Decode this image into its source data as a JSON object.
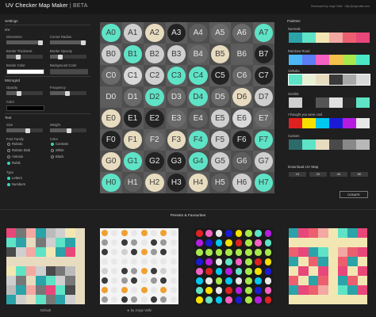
{
  "header": {
    "title": "UV Checker Map Maker",
    "separator": " | ",
    "badge": "BETA",
    "credits": "Developed by Jorge Valle · http://jorgevalle.com"
  },
  "settings": {
    "title": "Settings",
    "uv_section": "UV",
    "dimension_label": "Dimension",
    "corner_radius_label": "Corner Radius",
    "border_thickness_label": "Border Thickness",
    "border_opacity_label": "Border Opacity",
    "border_color_label": "Border Color",
    "background_color_label": "Background Color",
    "microgrid_section": "Microgrid",
    "opacity_label": "Opacity",
    "frequency_label": "Frequency",
    "color_label": "Color",
    "text_section": "Text",
    "size_label": "Size",
    "weight_label": "Weight",
    "font_family_label": "Font Family",
    "fonts": [
      "Roboto",
      "Roboto Slab",
      "Antonio",
      "Rubik"
    ],
    "font_selected": "Rubik",
    "color_section_label": "Color",
    "text_colors": [
      "Contrast",
      "White",
      "Black"
    ],
    "text_color_selected": "Contrast",
    "type_label": "Type",
    "types": [
      "Letters",
      "Numbers"
    ],
    "types_selected": [
      "Letters",
      "Numbers"
    ],
    "levels": {
      "dimension": 0.92,
      "corner_radius": 0.9,
      "border_thickness": 0.3,
      "border_opacity": 0.25,
      "opacity": 0.3,
      "frequency": 0.45,
      "size": 0.55,
      "weight": 0.5
    }
  },
  "grid": {
    "rows": [
      {
        "labels": [
          "A0",
          "A1",
          "A2",
          "A3",
          "A4",
          "A5",
          "A6",
          "A7"
        ],
        "colors": [
          "#5ee3c6",
          "#cfcfcf",
          "#e8dcc0",
          "#222222",
          "#5e5e5e",
          "#6a6a6a",
          "#6a6a6a",
          "#5ee3c6"
        ]
      },
      {
        "labels": [
          "B0",
          "B1",
          "B2",
          "B3",
          "B4",
          "B5",
          "B6",
          "B7"
        ],
        "colors": [
          "#cfcfcf",
          "#5ee3c6",
          "#cfcfcf",
          "#cfcfcf",
          "#6a6a6a",
          "#e8dcc0",
          "#5e5e5e",
          "#222222"
        ]
      },
      {
        "labels": [
          "C0",
          "C1",
          "C2",
          "C3",
          "C4",
          "C5",
          "C6",
          "C7"
        ],
        "colors": [
          "#6a6a6a",
          "#d9d9d9",
          "#cfcfcf",
          "#5ee3c6",
          "#5ee3c6",
          "#222222",
          "#6a6a6a",
          "#222222"
        ]
      },
      {
        "labels": [
          "D0",
          "D1",
          "D2",
          "D3",
          "D4",
          "D5",
          "D6",
          "D7"
        ],
        "colors": [
          "#5e5e5e",
          "#6a6a6a",
          "#5ee3c6",
          "#6a6a6a",
          "#5ee3c6",
          "#6a6a6a",
          "#e8dcc0",
          "#cfcfcf"
        ]
      },
      {
        "labels": [
          "E0",
          "E1",
          "E2",
          "E3",
          "E4",
          "E5",
          "E6",
          "E7"
        ],
        "colors": [
          "#e8dcc0",
          "#222222",
          "#222222",
          "#6a6a6a",
          "#5e5e5e",
          "#cfcfcf",
          "#d9d9d9",
          "#6a6a6a"
        ]
      },
      {
        "labels": [
          "F0",
          "F1",
          "F2",
          "F3",
          "F4",
          "F5",
          "F6",
          "F7"
        ],
        "colors": [
          "#222222",
          "#e8dcc0",
          "#6a6a6a",
          "#e8dcc0",
          "#5ee3c6",
          "#cfcfcf",
          "#222222",
          "#5ee3c6"
        ]
      },
      {
        "labels": [
          "G0",
          "G1",
          "G2",
          "G3",
          "G4",
          "G5",
          "G6",
          "G7"
        ],
        "colors": [
          "#e8dcc0",
          "#5ee3c6",
          "#222222",
          "#222222",
          "#5ee3c6",
          "#cfcfcf",
          "#5e5e5e",
          "#cfcfcf"
        ]
      },
      {
        "labels": [
          "H0",
          "H1",
          "H2",
          "H3",
          "H4",
          "H5",
          "H6",
          "H7"
        ],
        "colors": [
          "#5ee3c6",
          "#5e5e5e",
          "#e8dcc0",
          "#222222",
          "#e8dcc0",
          "#5e5e5e",
          "#cfcfcf",
          "#5ee3c6"
        ]
      }
    ]
  },
  "palettes": {
    "title": "Palettes",
    "items": [
      {
        "label": "Normals",
        "colors": [
          "#2ba3a8",
          "#5ee3c6",
          "#f2e7b3",
          "#f3a8a2",
          "#ec5f6e",
          "#e8477a"
        ]
      },
      {
        "label": "Rainbow Road",
        "colors": [
          "#4bb8f5",
          "#5b7df5",
          "#f560c3",
          "#f5c04b",
          "#a8e84b",
          "#4be8c7"
        ]
      },
      {
        "label": "Valhalla",
        "colors": [
          "#5ee3c6",
          "#e8f0d6",
          "#e8dcc0",
          "#3a3a3a",
          "#a8a8a8",
          "#d9d9d9"
        ]
      },
      {
        "label": "Gambit",
        "colors": [
          "#cfcfcf",
          "#1e1e1e",
          "#555555",
          "#e0e0e0",
          "#2a2a2a",
          "#5ee3c6"
        ]
      },
      {
        "label": "I thought you were cool",
        "colors": [
          "#e02121",
          "#f5e000",
          "#00c8f0",
          "#1b1bd6",
          "#b61ce0",
          "#e8e8e8"
        ]
      },
      {
        "label": "Custom",
        "colors": [
          "#2d6b6b",
          "#5ee3c6",
          "#e8dcc0",
          "#4a4a4a",
          "#888888",
          "#b8b8b8"
        ]
      }
    ],
    "selected": "Valhalla"
  },
  "download": {
    "title": "Download UV Map",
    "sizes": [
      "1K",
      "2K",
      "4K",
      "8K"
    ],
    "donate": "DONATE"
  },
  "presets": {
    "title": "Presets & Favourites",
    "captions": [
      "Default",
      "★ by Jorge Valle",
      "",
      ""
    ]
  }
}
